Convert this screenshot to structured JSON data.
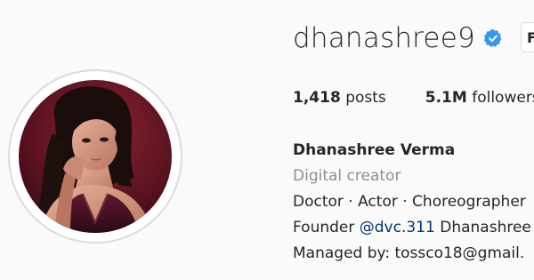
{
  "profile": {
    "username": "dhanashree9",
    "verified_icon": "verified-badge-icon",
    "follow_button_label": "F",
    "stats": {
      "posts_count": "1,418",
      "posts_label": "posts",
      "followers_count": "5.1M",
      "followers_label": "followers"
    },
    "bio": {
      "full_name": "Dhanashree Verma",
      "category": "Digital creator",
      "line1": "Doctor · Actor · Choreographer",
      "line2_prefix": "Founder ",
      "line2_mention": "@dvc.311",
      "line2_suffix": " Dhanashree",
      "line3": "Managed by: tossco18@gmail."
    }
  },
  "colors": {
    "background": "#fafafa",
    "text": "#262626",
    "secondary_text": "#8e8e8e",
    "verified_blue": "#3897f0",
    "mention_link": "#00376b",
    "avatar_ring": "#dbdbdb"
  }
}
